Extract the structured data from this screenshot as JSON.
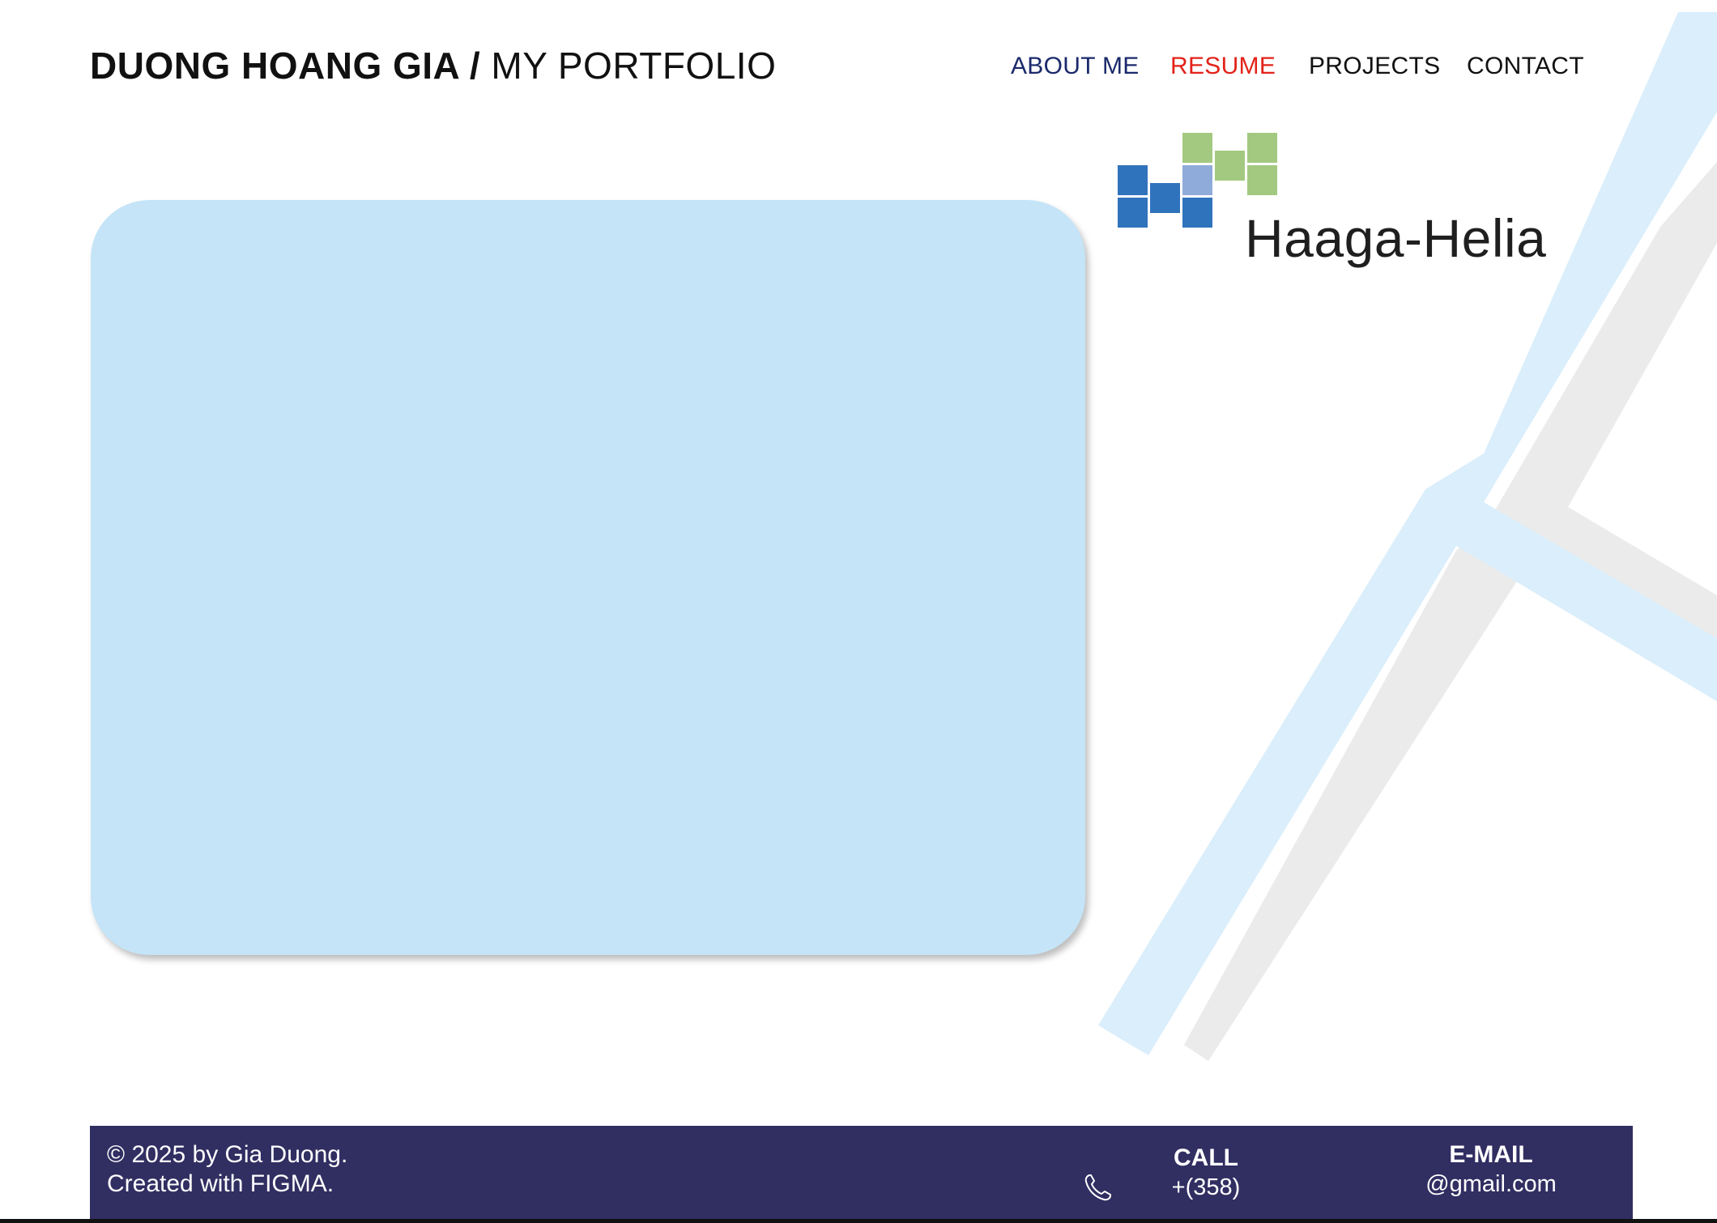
{
  "header": {
    "name": "DUONG HOANG GIA /",
    "subtitle": "MY PORTFOLIO"
  },
  "nav": {
    "items": [
      {
        "label": "ABOUT ME",
        "color": "#1b2a6b"
      },
      {
        "label": "RESUME",
        "color": "#e2231a"
      },
      {
        "label": "PROJECTS",
        "color": "#111111"
      },
      {
        "label": "CONTACT",
        "color": "#111111"
      }
    ]
  },
  "logo": {
    "text": "Haaga-Helia"
  },
  "footer": {
    "copyright_line1": "© 2025 by Gia Duong.",
    "copyright_line2": "Created with FIGMA.",
    "call_label": "CALL",
    "call_value": "+(358)",
    "email_label": "E-MAIL",
    "email_value": "@gmail.com"
  },
  "colors": {
    "footer_bg": "#312e62",
    "photo_placeholder": "#c5e4f7",
    "deco_blue": "#daeefb",
    "deco_gray": "#ebebeb"
  },
  "icons": [
    "phone-icon"
  ]
}
